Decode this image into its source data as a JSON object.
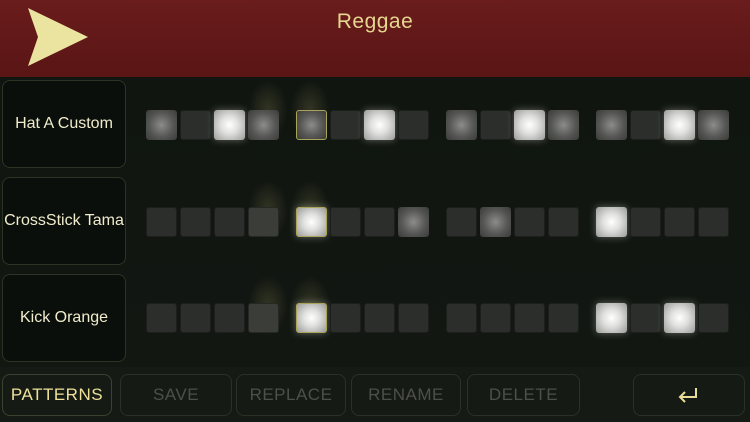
{
  "header": {
    "title": "Reggae",
    "play_icon": "play-triangle-icon",
    "accent_color": "#e8df9a"
  },
  "tracks": [
    {
      "label": "Hat A Custom",
      "steps": [
        "mid",
        "off",
        "on",
        "mid",
        "accent-mid",
        "off",
        "on",
        "off",
        "mid",
        "off",
        "on",
        "mid",
        "mid",
        "off",
        "on",
        "mid"
      ]
    },
    {
      "label": "CrossStick Tama",
      "steps": [
        "off",
        "off",
        "off",
        "dim",
        "accent-on",
        "off",
        "off",
        "mid",
        "off",
        "mid",
        "off",
        "off",
        "on",
        "off",
        "off",
        "off"
      ]
    },
    {
      "label": "Kick Orange",
      "steps": [
        "off",
        "off",
        "off",
        "dim",
        "accent-on",
        "off",
        "off",
        "off",
        "off",
        "off",
        "off",
        "off",
        "on",
        "off",
        "on",
        "off"
      ]
    }
  ],
  "toolbar": {
    "patterns_label": "PATTERNS",
    "save_label": "SAVE",
    "replace_label": "REPLACE",
    "rename_label": "RENAME",
    "delete_label": "DELETE",
    "enter_icon": "return-arrow-icon"
  }
}
